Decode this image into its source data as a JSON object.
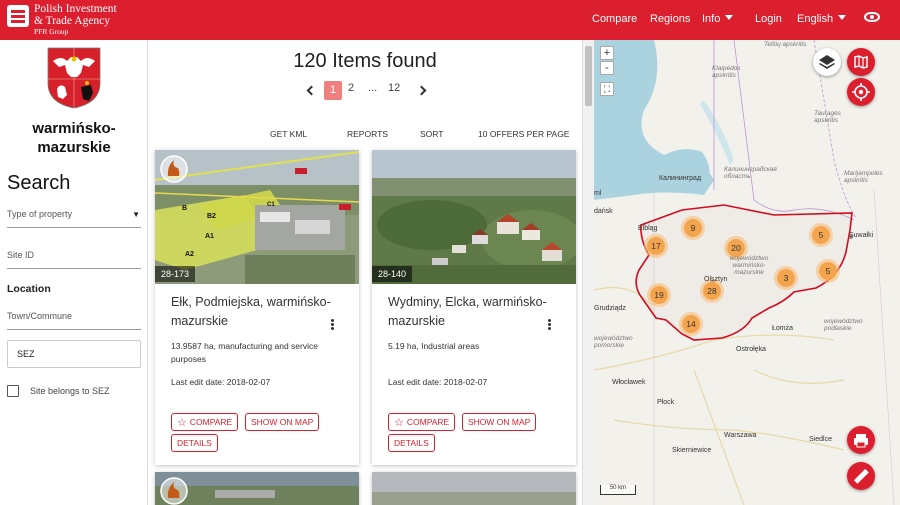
{
  "header": {
    "logo_line1": "Polish Investment",
    "logo_line2": "& Trade Agency",
    "logo_sub": "PFR Group",
    "nav": [
      "Compare",
      "Regions",
      "Info",
      "Login",
      "English"
    ]
  },
  "sidebar": {
    "region_line1": "warmińsko-",
    "region_line2": "mazurskie",
    "search_title": "Search",
    "type_placeholder": "Type of property",
    "site_id_placeholder": "Site ID",
    "location_label": "Location",
    "town_placeholder": "Town/Commune",
    "sez_value": "SEZ",
    "checkbox_label": "Site belongs to SEZ"
  },
  "results": {
    "count_text": "120 Items found",
    "pages": [
      "1",
      "2",
      "...",
      "12"
    ],
    "active_page": "1",
    "toolbar": [
      "GET KML",
      "REPORTS",
      "SORT",
      "10 OFFERS PER PAGE"
    ]
  },
  "cards": [
    {
      "id": "28-173",
      "title": "Ełk, Podmiejska, warmińsko-mazurskie",
      "desc": "13.9587 ha, manufacturing and service purposes",
      "date": "Last edit date: 2018-02-07",
      "compare": "COMPARE",
      "show_on_map": "SHOW ON MAP",
      "details": "DETAILS"
    },
    {
      "id": "28-140",
      "title": "Wydminy, Elcka, warmińsko-mazurskie",
      "desc": "5.19 ha, Industrial areas",
      "date": "Last edit date: 2018-02-07",
      "compare": "COMPARE",
      "show_on_map": "SHOW ON MAP",
      "details": "DETAILS"
    }
  ],
  "map": {
    "zoom_in": "+",
    "zoom_out": "-",
    "clusters": [
      "9",
      "17",
      "20",
      "5",
      "3",
      "5",
      "28",
      "19",
      "14"
    ],
    "labels": {
      "telsiu": "Telšių apskritis",
      "klaipedos": "Klaipėdos apskritis",
      "taurages": "Tauragės apskritis",
      "kaliningrad": "Калининград",
      "kal_oblast": "Калининградская область",
      "marijampoles": "Marijampolės apskritis",
      "suwalki": "Suwałki",
      "olsztyn": "Olsztyn",
      "wm_label": "województwo warmińsko-mazurskie",
      "gdansk": "dańsk",
      "elblag": "Elbląg",
      "grudziadz": "Grudziądz",
      "lomza": "Łomża",
      "podlaskie": "województwo podlaskie",
      "ostroleka": "Ostrołęka",
      "wloclawek": "Włocławek",
      "plock": "Płock",
      "warszawa": "Warszawa",
      "siedlce": "Siedlce",
      "skierniewice": "Skierniewice",
      "pomorskie": "województwo pomorskie",
      "ml": "ml",
      "scale": "50 km"
    }
  },
  "colors": {
    "brand_red": "#dc1f2e",
    "cluster": "#f5a44e",
    "sea": "#aad3df",
    "border": "#d00c1e"
  }
}
